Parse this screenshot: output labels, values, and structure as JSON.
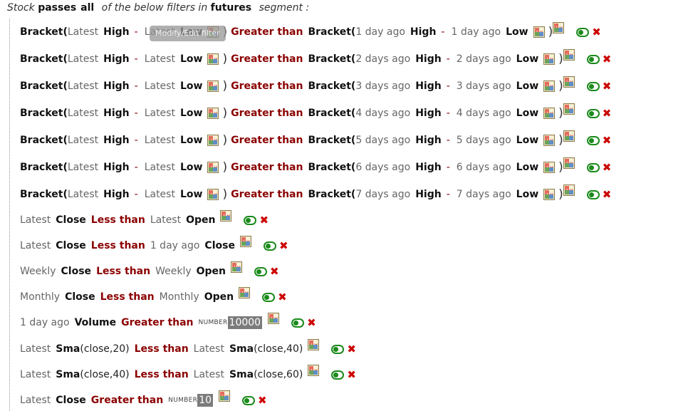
{
  "header": {
    "stock": "Stock",
    "passes": "passes",
    "all": "all",
    "of_below": "of the below filters in",
    "segment_name": "futures",
    "segment": "segment :"
  },
  "tooltip": "Modify/Edit filter",
  "bracket_rows": [
    {
      "bracket": "Bracket(",
      "ta": "Latest",
      "ha": "High",
      "minus": "-",
      "tb": "Latest",
      "la": "Low",
      "close": ")",
      "op": "Greater than",
      "bracket2": "Bracket(",
      "tc": "1 day ago",
      "hb": "High",
      "td": "1 day ago",
      "lb": "Low"
    },
    {
      "bracket": "Bracket(",
      "ta": "Latest",
      "ha": "High",
      "minus": "-",
      "tb": "Latest",
      "la": "Low",
      "close": ")",
      "op": "Greater than",
      "bracket2": "Bracket(",
      "tc": "2 days ago",
      "hb": "High",
      "td": "2 days ago",
      "lb": "Low"
    },
    {
      "bracket": "Bracket(",
      "ta": "Latest",
      "ha": "High",
      "minus": "-",
      "tb": "Latest",
      "la": "Low",
      "close": ")",
      "op": "Greater than",
      "bracket2": "Bracket(",
      "tc": "3 days ago",
      "hb": "High",
      "td": "3 days ago",
      "lb": "Low"
    },
    {
      "bracket": "Bracket(",
      "ta": "Latest",
      "ha": "High",
      "minus": "-",
      "tb": "Latest",
      "la": "Low",
      "close": ")",
      "op": "Greater than",
      "bracket2": "Bracket(",
      "tc": "4 days ago",
      "hb": "High",
      "td": "4 days ago",
      "lb": "Low"
    },
    {
      "bracket": "Bracket(",
      "ta": "Latest",
      "ha": "High",
      "minus": "-",
      "tb": "Latest",
      "la": "Low",
      "close": ")",
      "op": "Greater than",
      "bracket2": "Bracket(",
      "tc": "5 days ago",
      "hb": "High",
      "td": "5 days ago",
      "lb": "Low"
    },
    {
      "bracket": "Bracket(",
      "ta": "Latest",
      "ha": "High",
      "minus": "-",
      "tb": "Latest",
      "la": "Low",
      "close": ")",
      "op": "Greater than",
      "bracket2": "Bracket(",
      "tc": "6 days ago",
      "hb": "High",
      "td": "6 days ago",
      "lb": "Low"
    },
    {
      "bracket": "Bracket(",
      "ta": "Latest",
      "ha": "High",
      "minus": "-",
      "tb": "Latest",
      "la": "Low",
      "close": ")",
      "op": "Greater than",
      "bracket2": "Bracket(",
      "tc": "7 days ago",
      "hb": "High",
      "td": "7 days ago",
      "lb": "Low"
    }
  ],
  "simple_rows": [
    {
      "t1": "Latest",
      "f1": "Close",
      "op": "Less than",
      "t2": "Latest",
      "f2": "Open"
    },
    {
      "t1": "Latest",
      "f1": "Close",
      "op": "Less than",
      "t2": "1 day ago",
      "f2": "Close"
    },
    {
      "t1": "Weekly",
      "f1": "Close",
      "op": "Less than",
      "t2": "Weekly",
      "f2": "Open"
    },
    {
      "t1": "Monthly",
      "f1": "Close",
      "op": "Less than",
      "t2": "Monthly",
      "f2": "Open"
    }
  ],
  "volume_row": {
    "t1": "1 day ago",
    "f1": "Volume",
    "op": "Greater than",
    "num_label": "NUMBER",
    "num_value": "10000"
  },
  "sma_rows": [
    {
      "t1": "Latest",
      "f1": "Sma",
      "a1": "(close,20)",
      "op": "Less than",
      "t2": "Latest",
      "f2": "Sma",
      "a2": "(close,40)"
    },
    {
      "t1": "Latest",
      "f1": "Sma",
      "a1": "(close,40)",
      "op": "Less than",
      "t2": "Latest",
      "f2": "Sma",
      "a2": "(close,60)"
    }
  ],
  "close_row": {
    "t1": "Latest",
    "f1": "Close",
    "op": "Greater than",
    "num_label": "NUMBER",
    "num_value": "10"
  },
  "icons": {
    "calc": "calculator-icon",
    "toggle": "toggle-icon",
    "delete": "delete-icon"
  },
  "colors": {
    "operator": "#8b0000",
    "toggle": "#1a8a1a",
    "delete": "#c00000"
  }
}
